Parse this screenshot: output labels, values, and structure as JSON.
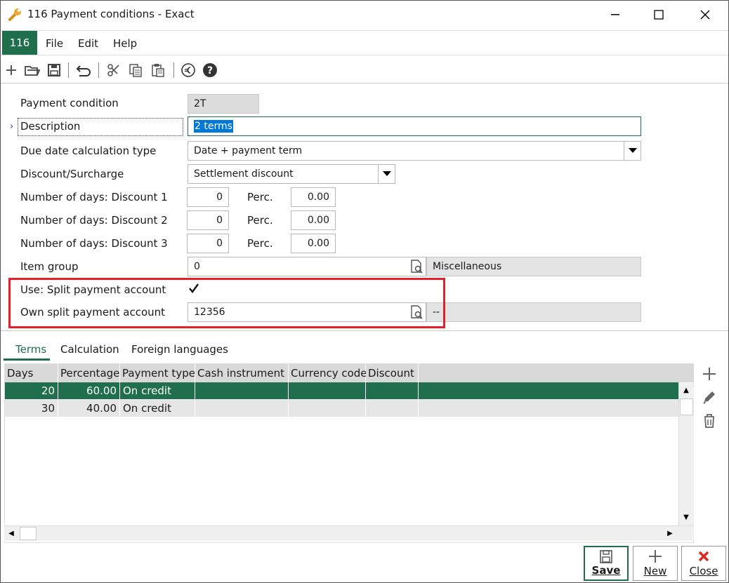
{
  "window": {
    "title": "116 Payment conditions - Exact"
  },
  "menu": {
    "badge": "116",
    "items": [
      "File",
      "Edit",
      "Help"
    ]
  },
  "form": {
    "payment_condition": {
      "label": "Payment condition",
      "value": "2T"
    },
    "description": {
      "label": "Description",
      "value": "2 terms"
    },
    "due_date_type": {
      "label": "Due date calculation type",
      "value": "Date + payment term"
    },
    "discount_surcharge": {
      "label": "Discount/Surcharge",
      "value": "Settlement discount"
    },
    "discounts": [
      {
        "label": "Number of days: Discount 1",
        "days": "0",
        "perc_label": "Perc.",
        "perc": "0.00"
      },
      {
        "label": "Number of days: Discount 2",
        "days": "0",
        "perc_label": "Perc.",
        "perc": "0.00"
      },
      {
        "label": "Number of days: Discount 3",
        "days": "0",
        "perc_label": "Perc.",
        "perc": "0.00"
      }
    ],
    "item_group": {
      "label": "Item group",
      "value": "0",
      "description": "Miscellaneous"
    },
    "use_split": {
      "label": "Use: Split payment account",
      "checked": true
    },
    "own_split": {
      "label": "Own split payment account",
      "value": "12356",
      "description": "--"
    }
  },
  "tabs": [
    "Terms",
    "Calculation",
    "Foreign languages"
  ],
  "grid": {
    "columns": [
      "Days",
      "Percentage",
      "Payment type",
      "Cash instrument",
      "Currency code",
      "Discount"
    ],
    "rows": [
      {
        "days": "20",
        "percentage": "60.00",
        "payment_type": "On credit",
        "cash_instrument": "",
        "currency_code": "",
        "discount": ""
      },
      {
        "days": "30",
        "percentage": "40.00",
        "payment_type": "On credit",
        "cash_instrument": "",
        "currency_code": "",
        "discount": ""
      }
    ]
  },
  "buttons": {
    "save": "Save",
    "new": "New",
    "close": "Close"
  },
  "colors": {
    "accent": "#1f6e4c",
    "highlight": "#e4202a",
    "selection": "#0078d7"
  }
}
